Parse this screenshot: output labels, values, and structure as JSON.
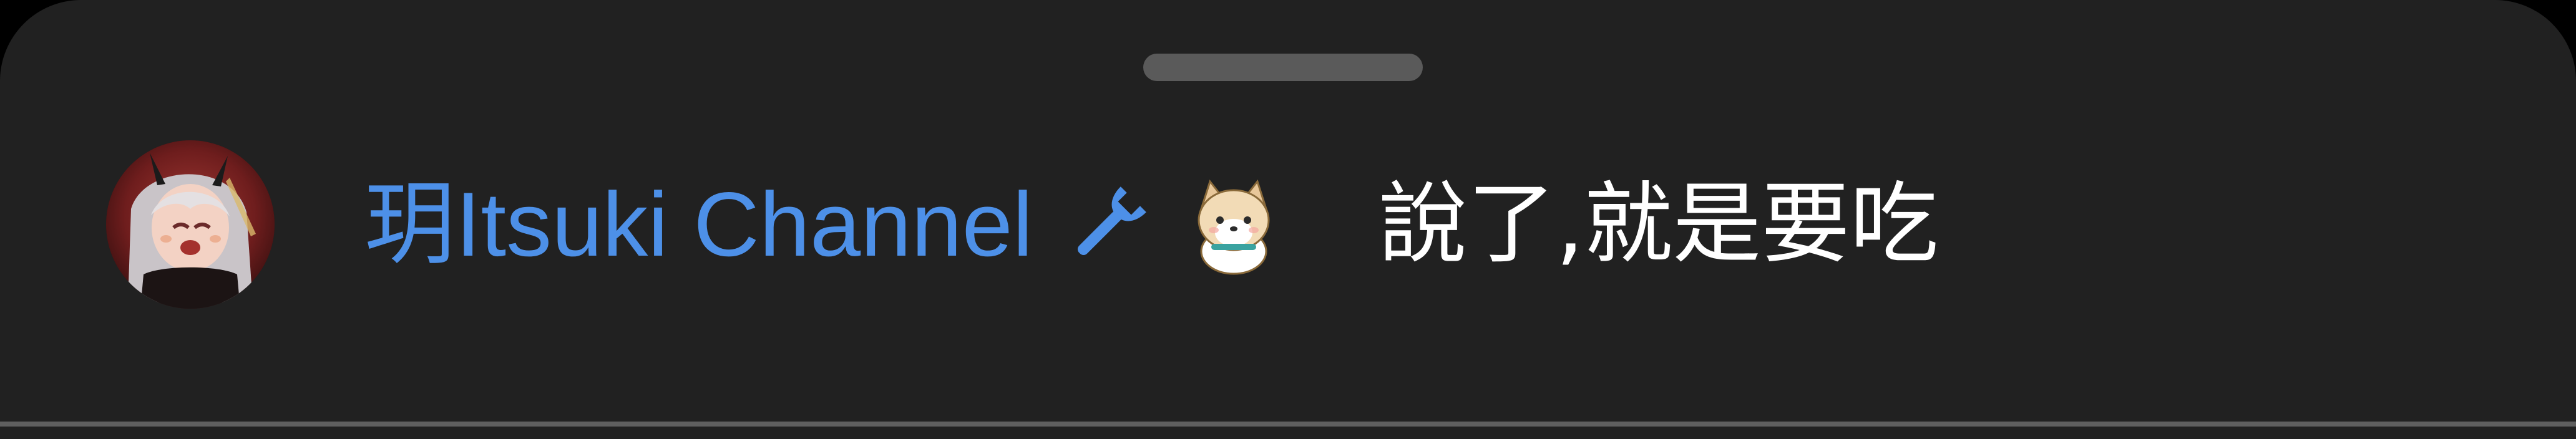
{
  "chat_message": {
    "author_name": "玥Itsuki Channel",
    "badges": [
      "wrench-icon",
      "shiba-dog-icon"
    ],
    "text": "說了,就是要吃"
  },
  "colors": {
    "sheet_background": "#212121",
    "author_name": "#4d90e8",
    "message_text": "#ffffff",
    "drag_handle": "#5a5a5a"
  }
}
